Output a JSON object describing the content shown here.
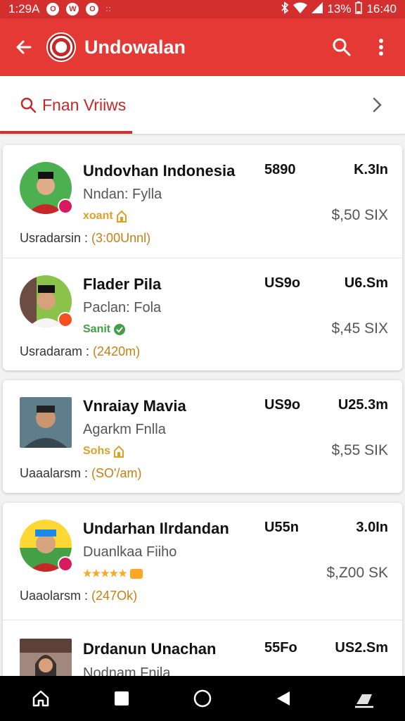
{
  "status_bar": {
    "time": "1:29",
    "time_suffix": "A",
    "notif_icons": [
      "O",
      "W",
      "O"
    ],
    "extra": "::",
    "battery": "13%",
    "clock": "16:40"
  },
  "app_bar": {
    "title": "Undowalan",
    "back_icon": "arrow-back-icon",
    "search_icon": "search-icon",
    "menu_icon": "more-vert-icon"
  },
  "filter": {
    "label": "Fnan Vriiws"
  },
  "colors": {
    "primary": "#e53935",
    "primary_dark": "#d32f2f",
    "accent_gold": "#e0a024",
    "accent_green": "#43a047"
  },
  "list": [
    {
      "name": "Undovhan Indonesia",
      "role": "Nndan: Fylla",
      "rating": "xoant",
      "code": "5890",
      "amount": "K.3In",
      "price": "$,50 SIX",
      "meta_label": "Usradarsin :",
      "meta_value": "(3:00Unnl)"
    },
    {
      "name": "Flader Pila",
      "role": "Paclan: Fola",
      "rating": "Sanit",
      "code": "US9o",
      "amount": "U6.Sm",
      "price": "$,45 SIX",
      "meta_label": "Usradaram :",
      "meta_value": "(2420m)"
    },
    {
      "name": "Vnraiay Mavia",
      "role": "Agarkm Fnlla",
      "rating": "Sohs",
      "code": "US9o",
      "amount": "U25.3m",
      "price": "$,55 SIK",
      "meta_label": "Uaaalarsm :",
      "meta_value": "(SO'/am)"
    },
    {
      "name": "Undarhan Ilrdandan",
      "role": "Duanlkaa Fiiho",
      "rating": "★★★★★",
      "code": "U55n",
      "amount": "3.0In",
      "price": "$,Z00 SK",
      "meta_label": "Uaaolarsm :",
      "meta_value": "(247Ok)"
    },
    {
      "name": "Drdanun Unachan",
      "role": "Nodnam Fnila",
      "code": "55Fo",
      "amount": "US2.Sm"
    }
  ]
}
